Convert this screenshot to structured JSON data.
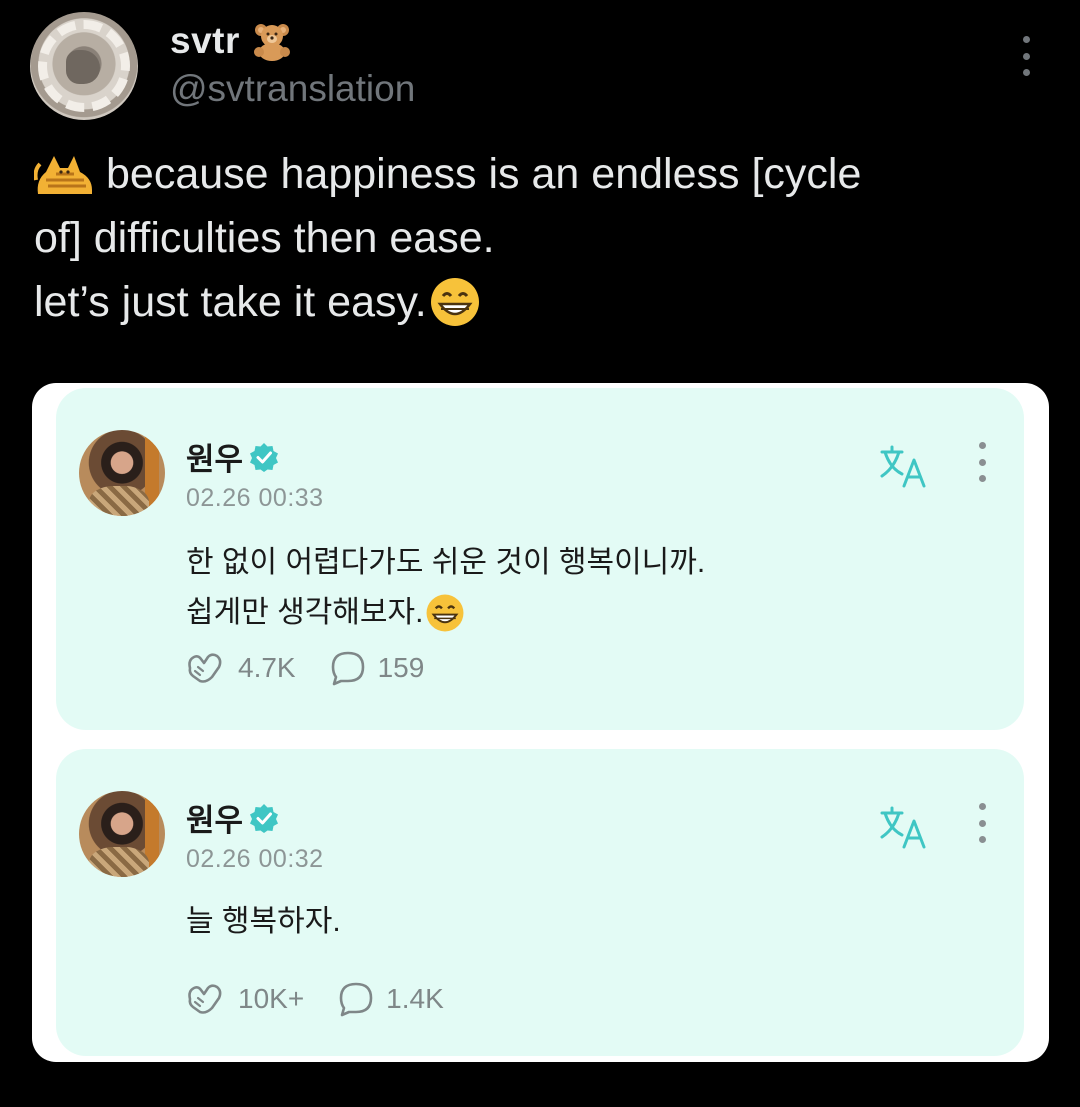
{
  "tweet": {
    "display_name": "svtr",
    "name_emoji": "teddy-bear",
    "handle": "@svtranslation",
    "text_lines": [
      "because happiness is an endless [cycle",
      "of] difficulties then ease.",
      "let’s just take it easy."
    ],
    "leading_emoji": "cat",
    "trailing_emoji": "grinning-face"
  },
  "embed": {
    "posts": [
      {
        "author": "원우",
        "verified": true,
        "timestamp": "02.26 00:33",
        "body_lines": [
          "한 없이 어렵다가도 쉬운 것이 행복이니까.",
          "쉽게만 생각해보자."
        ],
        "likes": "4.7K",
        "comments": "159"
      },
      {
        "author": "원우",
        "verified": true,
        "timestamp": "02.26 00:32",
        "body_lines": [
          "늘 행복하자."
        ],
        "likes": "10K+",
        "comments": "1.4K"
      }
    ]
  },
  "colors": {
    "background": "#000000",
    "text_primary": "#e7e9ea",
    "text_secondary": "#71767b",
    "card_background": "#e3fbf5",
    "accent_teal": "#3fc6c4"
  }
}
